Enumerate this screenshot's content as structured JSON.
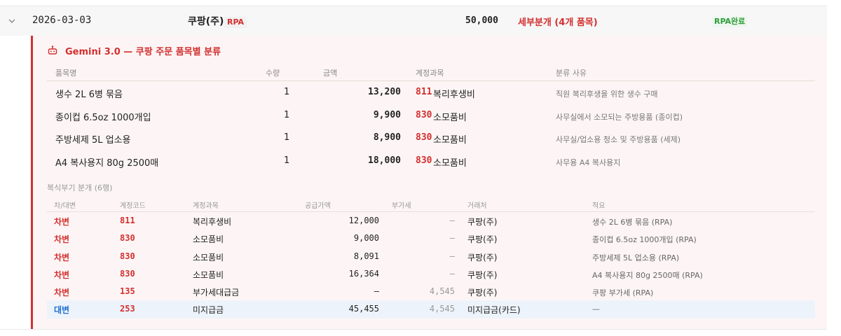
{
  "header_row": {
    "date": "2026-03-03",
    "vendor": "쿠팡(주)",
    "vendor_tag": "RPA",
    "amount": "50,000",
    "split_label": "세부분개 (4개 품목)",
    "status": "RPA완료"
  },
  "classification": {
    "title": "Gemini 3.0 — 쿠팡 주문 품목별 분류",
    "columns": {
      "name": "품목명",
      "qty": "수량",
      "amount": "금액",
      "account": "계정과목",
      "reason": "분류 사유"
    },
    "items": [
      {
        "name": "생수 2L 6병 묶음",
        "qty": "1",
        "amount": "13,200",
        "code": "811",
        "account": "복리후생비",
        "reason": "직원 복리후생을 위한 생수 구매"
      },
      {
        "name": "종이컵 6.5oz 1000개입",
        "qty": "1",
        "amount": "9,900",
        "code": "830",
        "account": "소모품비",
        "reason": "사무실에서 소모되는 주방용품 (종이컵)"
      },
      {
        "name": "주방세제 5L 업소용",
        "qty": "1",
        "amount": "8,900",
        "code": "830",
        "account": "소모품비",
        "reason": "사무실/업소용 청소 및 주방용품 (세제)"
      },
      {
        "name": "A4 복사용지 80g 2500매",
        "qty": "1",
        "amount": "18,000",
        "code": "830",
        "account": "소모품비",
        "reason": "사무용 A4 복사용지"
      }
    ]
  },
  "journal": {
    "title": "복식부기 분개 (6행)",
    "columns": {
      "side": "차/대변",
      "code": "계정코드",
      "account": "계정과목",
      "supply": "공급가액",
      "vat": "부가세",
      "party": "거래처",
      "memo": "적요"
    },
    "rows": [
      {
        "side": "차변",
        "type": "debit",
        "code": "811",
        "account": "복리후생비",
        "supply": "12,000",
        "vat": "—",
        "party": "쿠팡(주)",
        "memo": "생수 2L 6병 묶음 (RPA)"
      },
      {
        "side": "차변",
        "type": "debit",
        "code": "830",
        "account": "소모품비",
        "supply": "9,000",
        "vat": "—",
        "party": "쿠팡(주)",
        "memo": "종이컵 6.5oz 1000개입 (RPA)"
      },
      {
        "side": "차변",
        "type": "debit",
        "code": "830",
        "account": "소모품비",
        "supply": "8,091",
        "vat": "—",
        "party": "쿠팡(주)",
        "memo": "주방세제 5L 업소용 (RPA)"
      },
      {
        "side": "차변",
        "type": "debit",
        "code": "830",
        "account": "소모품비",
        "supply": "16,364",
        "vat": "—",
        "party": "쿠팡(주)",
        "memo": "A4 복사용지 80g 2500매 (RPA)"
      },
      {
        "side": "차변",
        "type": "debit",
        "code": "135",
        "account": "부가세대급금",
        "supply": "—",
        "vat": "4,545",
        "party": "쿠팡(주)",
        "memo": "쿠팡 부가세 (RPA)"
      },
      {
        "side": "대변",
        "type": "credit",
        "code": "253",
        "account": "미지급금",
        "supply": "45,455",
        "vat": "4,545",
        "party": "미지급금(카드)",
        "memo": "—"
      }
    ]
  },
  "colors": {
    "accent": "#d32f2f",
    "credit": "#1f6fd1",
    "success": "#2e9d3a",
    "panel_bg": "#fdf5f5"
  },
  "icons": {
    "expand": "chevron-down-icon",
    "ai": "robot-icon"
  }
}
